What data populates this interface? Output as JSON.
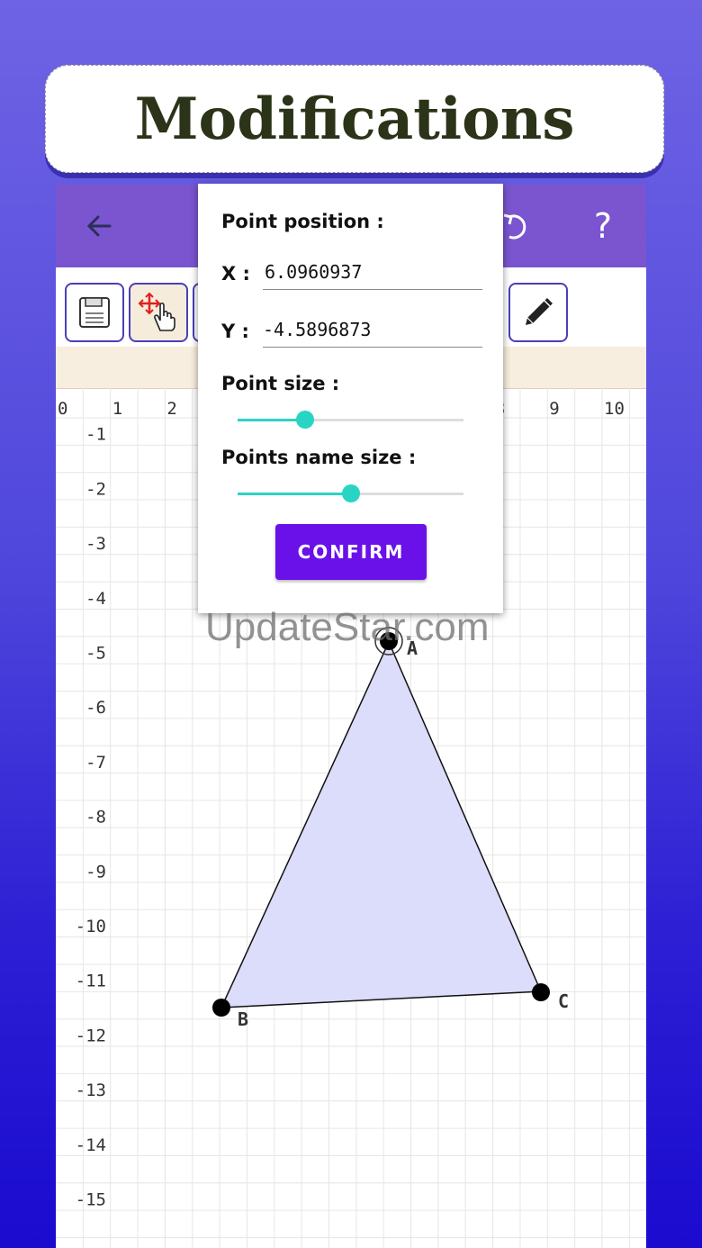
{
  "banner": {
    "title": "Modifications"
  },
  "appbar": {
    "back_icon": "arrow-left-icon",
    "undo_icon": "undo-icon",
    "help_label": "?"
  },
  "toolbar": {
    "tools": [
      "save-icon",
      "move-icon",
      "pencil-icon"
    ]
  },
  "axes": {
    "x_labels": [
      "0",
      "1",
      "2",
      "8",
      "9",
      "10"
    ],
    "y_labels": [
      "-1",
      "-2",
      "-3",
      "-4",
      "-5",
      "-6",
      "-7",
      "-8",
      "-9",
      "-10",
      "-11",
      "-12",
      "-13",
      "-14",
      "-15"
    ]
  },
  "points": [
    {
      "name": "A"
    },
    {
      "name": "B"
    },
    {
      "name": "C"
    }
  ],
  "dialog": {
    "point_position_label": "Point position :",
    "x_label": "X :",
    "x_value": "6.0960937",
    "y_label": "Y :",
    "y_value": "-4.5896873",
    "point_size_label": "Point size :",
    "point_size_fraction": 0.3,
    "points_name_size_label": "Points name size :",
    "points_name_size_fraction": 0.5,
    "confirm_label": "CONFIRM"
  },
  "watermark": "UpdateStar.com",
  "colors": {
    "accent": "#6a11e9",
    "slider": "#2ad4c4",
    "appbar": "#7a55cf",
    "triangle_fill": "#dcdcfb"
  }
}
